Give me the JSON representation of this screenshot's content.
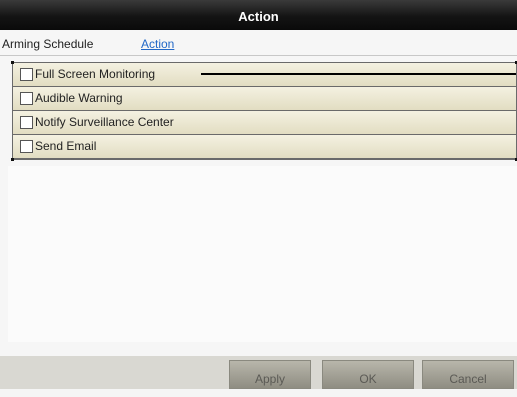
{
  "window": {
    "title": "Action"
  },
  "tabs": [
    {
      "label": "Arming Schedule",
      "active": false
    },
    {
      "label": "Action",
      "active": true
    }
  ],
  "actions": [
    {
      "label": "Full Screen Monitoring",
      "checked": false
    },
    {
      "label": "Audible Warning",
      "checked": false
    },
    {
      "label": "Notify Surveillance Center",
      "checked": false
    },
    {
      "label": "Send Email",
      "checked": false
    }
  ],
  "footer": {
    "apply_label": "Apply",
    "ok_label": "OK",
    "cancel_label": "Cancel"
  },
  "colors": {
    "title_bar": "#141414",
    "active_tab": "#2268c7",
    "list_bg": "#ece9d4",
    "button_bg": "#a3a196"
  }
}
